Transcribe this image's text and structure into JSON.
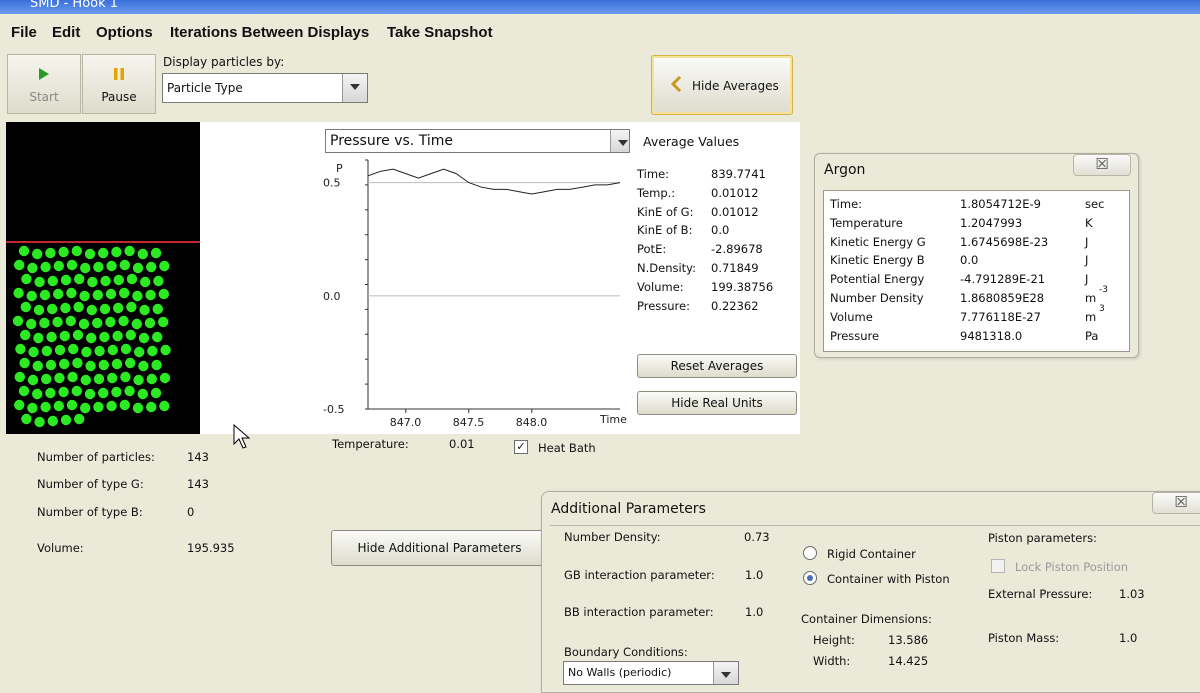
{
  "window": {
    "title": "SMD - Hook 1"
  },
  "menu": [
    "File",
    "Edit",
    "Options",
    "Iterations Between Displays",
    "Take Snapshot"
  ],
  "toolbar": {
    "start": "Start",
    "pause": "Pause",
    "display_label": "Display particles by:",
    "display_value": "Particle Type",
    "hide_averages": "Hide Averages"
  },
  "graph": {
    "selector": "Pressure vs. Time",
    "y_axis_label": "P",
    "x_axis_label": "Time"
  },
  "chart_data": {
    "type": "line",
    "title": "Pressure vs. Time",
    "xlabel": "Time",
    "ylabel": "P",
    "xlim": [
      846.7,
      848.7
    ],
    "ylim": [
      -0.5,
      0.6
    ],
    "x_ticks": [
      "847.0",
      "847.5",
      "848.0"
    ],
    "y_ticks": [
      "0.5",
      "0.0",
      "-0.5"
    ],
    "series": [
      {
        "x": [
          846.7,
          846.8,
          846.9,
          847.0,
          847.1,
          847.2,
          847.3,
          847.4,
          847.5,
          847.6,
          847.7,
          847.8,
          847.9,
          848.0,
          848.1,
          848.2,
          848.3,
          848.4,
          848.5,
          848.6,
          848.7
        ],
        "values": [
          0.53,
          0.55,
          0.56,
          0.54,
          0.52,
          0.54,
          0.56,
          0.54,
          0.5,
          0.48,
          0.47,
          0.47,
          0.46,
          0.45,
          0.46,
          0.47,
          0.47,
          0.48,
          0.49,
          0.49,
          0.5
        ]
      }
    ],
    "reference_lines": [
      0.5,
      0.0
    ]
  },
  "averages": {
    "title": "Average Values",
    "rows": [
      {
        "label": "Time:",
        "value": "839.7741"
      },
      {
        "label": "Temp.:",
        "value": "0.01012"
      },
      {
        "label": "KinE of G:",
        "value": "0.01012"
      },
      {
        "label": "KinE of B:",
        "value": "0.0"
      },
      {
        "label": "PotE:",
        "value": "-2.89678"
      },
      {
        "label": "N.Density:",
        "value": "0.71849"
      },
      {
        "label": "Volume:",
        "value": "199.38756"
      },
      {
        "label": "Pressure:",
        "value": "0.22362"
      }
    ],
    "reset_button": "Reset Averages",
    "hide_real_units_button": "Hide Real Units"
  },
  "temperature": {
    "label": "Temperature:",
    "value": "0.01",
    "heat_bath_label": "Heat Bath",
    "heat_bath_checked": true
  },
  "stats": [
    {
      "label": "Number of particles:",
      "value": "143"
    },
    {
      "label": "Number of type G:",
      "value": "143"
    },
    {
      "label": "Number of type B:",
      "value": "0"
    },
    {
      "label": "Volume:",
      "value": "195.935"
    }
  ],
  "hide_additional_button": "Hide Additional Parameters",
  "argon": {
    "title": "Argon",
    "close": "☒",
    "rows": [
      {
        "label": "Time:",
        "value": "1.8054712E-9",
        "unit": "sec"
      },
      {
        "label": "Temperature",
        "value": "1.2047993",
        "unit": "K"
      },
      {
        "label": "Kinetic Energy G",
        "value": "1.6745698E-23",
        "unit": "J"
      },
      {
        "label": "Kinetic Energy B",
        "value": "0.0",
        "unit": "J"
      },
      {
        "label": "Potential Energy",
        "value": "-4.791289E-21",
        "unit": "J"
      },
      {
        "label": "Number Density",
        "value": "1.8680859E28",
        "unit": "m",
        "sup": "-3"
      },
      {
        "label": "Volume",
        "value": "7.776118E-27",
        "unit": "m",
        "sup": "3"
      },
      {
        "label": "Pressure",
        "value": "9481318.0",
        "unit": "Pa"
      }
    ]
  },
  "additional": {
    "title": "Additional Parameters",
    "close": "☒",
    "number_density_label": "Number Density:",
    "number_density_value": "0.73",
    "gb_label": "GB interaction parameter:",
    "gb_value": "1.0",
    "bb_label": "BB interaction parameter:",
    "bb_value": "1.0",
    "boundary_label": "Boundary Conditions:",
    "boundary_value": "No Walls (periodic)",
    "rigid_label": "Rigid Container",
    "piston_label": "Container with Piston",
    "dims_label": "Container Dimensions:",
    "height_label": "Height:",
    "height_value": "13.586",
    "width_label": "Width:",
    "width_value": "14.425",
    "piston_params_label": "Piston parameters:",
    "lock_piston_label": "Lock Piston Position",
    "external_pressure_label": "External Pressure:",
    "external_pressure_value": "1.03",
    "piston_mass_label": "Piston Mass:",
    "piston_mass_value": "1.0"
  },
  "colors": {
    "particle": "#2bea22",
    "piston_line": "#c1262a",
    "window_bg": "#ebe9d8"
  }
}
